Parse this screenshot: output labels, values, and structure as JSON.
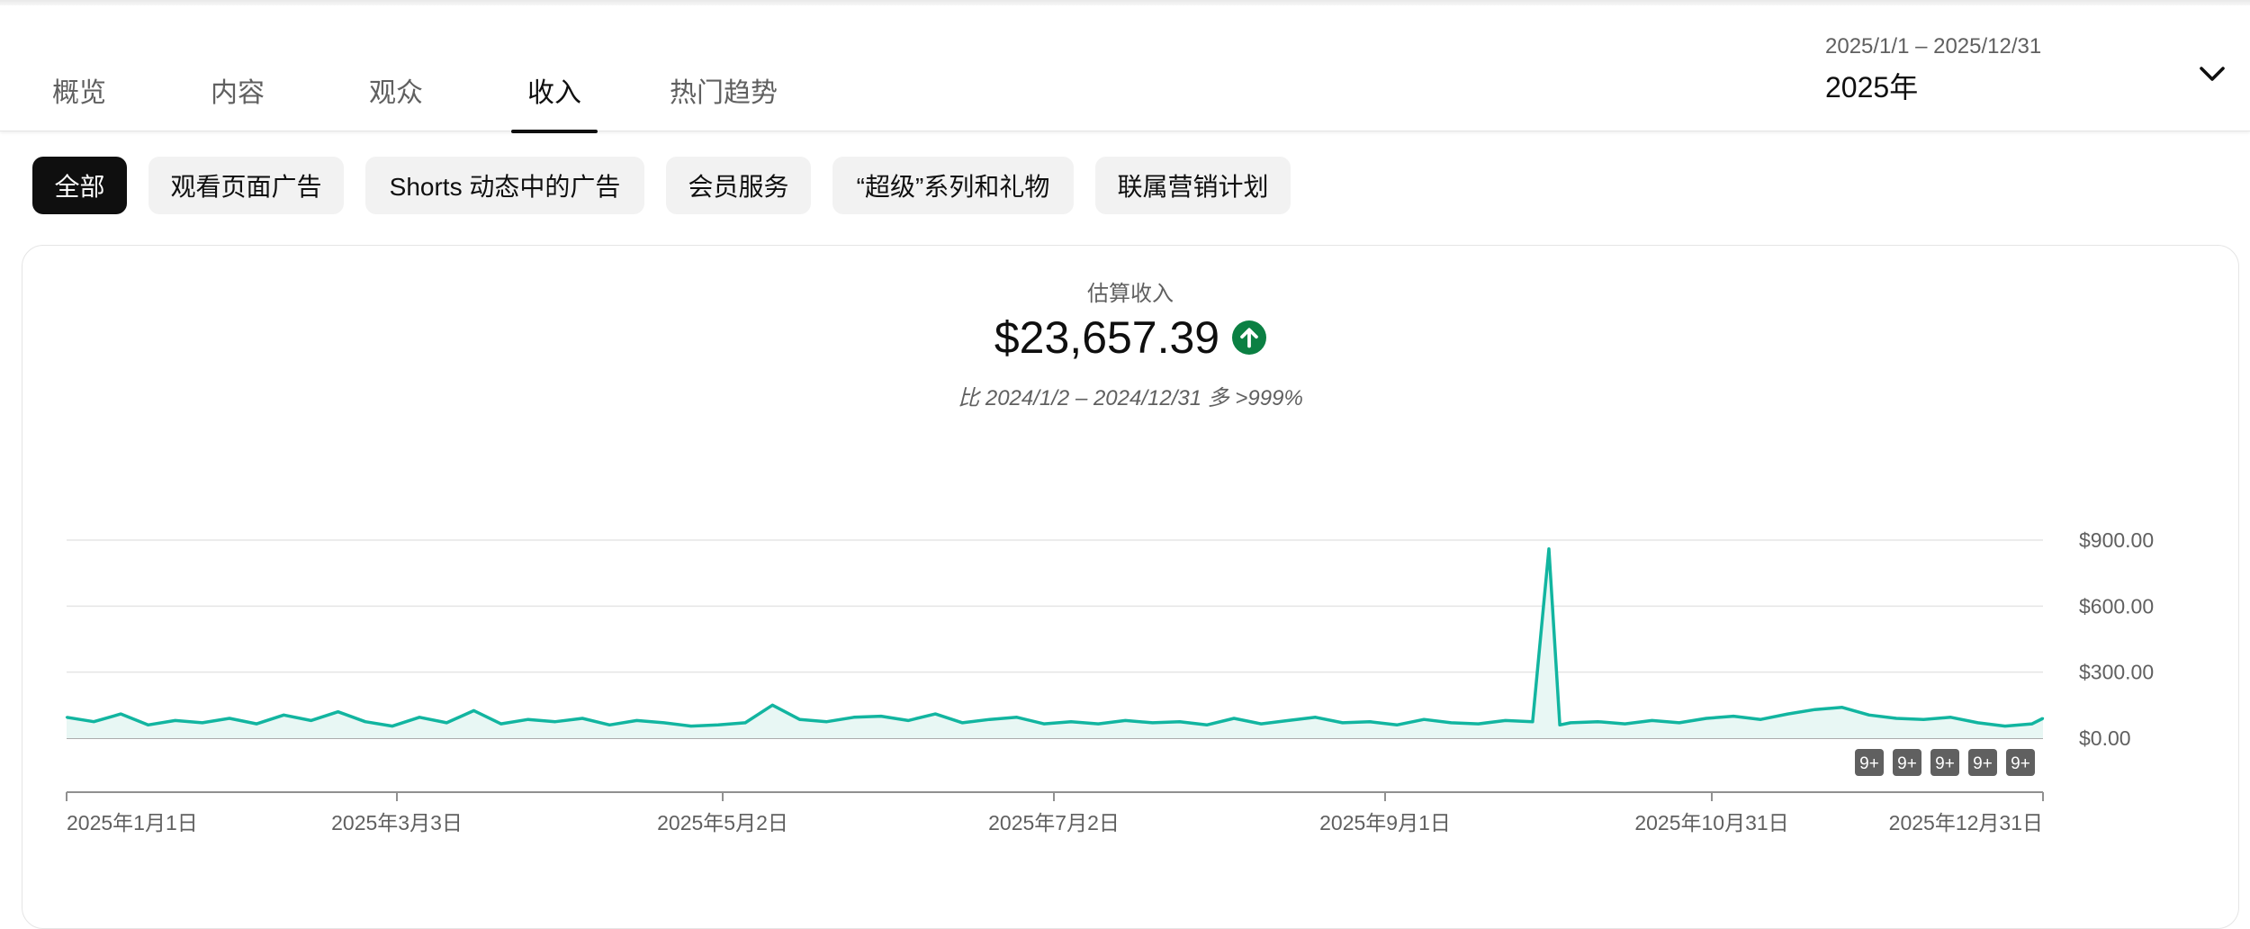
{
  "tabs": [
    {
      "label": "概览",
      "active": false
    },
    {
      "label": "内容",
      "active": false
    },
    {
      "label": "观众",
      "active": false
    },
    {
      "label": "收入",
      "active": true
    },
    {
      "label": "热门趋势",
      "active": false
    }
  ],
  "date_range": {
    "range": "2025/1/1 – 2025/12/31",
    "label": "2025年"
  },
  "chips": [
    {
      "label": "全部",
      "active": true
    },
    {
      "label": "观看页面广告",
      "active": false
    },
    {
      "label": "Shorts 动态中的广告",
      "active": false
    },
    {
      "label": "会员服务",
      "active": false
    },
    {
      "label": "“超级”系列和礼物",
      "active": false
    },
    {
      "label": "联属营销计划",
      "active": false
    }
  ],
  "metric": {
    "label": "估算收入",
    "value": "$23,657.39",
    "trend_icon": "arrow-up-circle-icon",
    "trend_color": "#0b8043",
    "comparison": "比 2024/1/2 – 2024/12/31 多 >999%"
  },
  "colors": {
    "line": "#12b5a0",
    "area": "#e8f7f4"
  },
  "chart_data": {
    "type": "area",
    "x_ticks": [
      "2025年1月1日",
      "2025年3月3日",
      "2025年5月2日",
      "2025年7月2日",
      "2025年9月1日",
      "2025年10月31日",
      "2025年12月31日"
    ],
    "y_ticks": [
      "$0.00",
      "$300.00",
      "$600.00",
      "$900.00"
    ],
    "ylim": [
      0,
      900
    ],
    "xlim": [
      "2025-01-01",
      "2025-12-31"
    ],
    "grid": true,
    "markers": [
      "9+",
      "9+",
      "9+",
      "9+",
      "9+"
    ],
    "series": [
      {
        "x": [
          "2025-01-01",
          "2025-01-06",
          "2025-01-11",
          "2025-01-16",
          "2025-01-21",
          "2025-01-26",
          "2025-01-31",
          "2025-02-05",
          "2025-02-10",
          "2025-02-15",
          "2025-02-20",
          "2025-02-25",
          "2025-03-02",
          "2025-03-07",
          "2025-03-12",
          "2025-03-17",
          "2025-03-22",
          "2025-03-27",
          "2025-04-01",
          "2025-04-06",
          "2025-04-11",
          "2025-04-16",
          "2025-04-21",
          "2025-04-26",
          "2025-05-01",
          "2025-05-06",
          "2025-05-11",
          "2025-05-16",
          "2025-05-21",
          "2025-05-26",
          "2025-05-31",
          "2025-06-05",
          "2025-06-10",
          "2025-06-15",
          "2025-06-20",
          "2025-06-25",
          "2025-06-30",
          "2025-07-05",
          "2025-07-10",
          "2025-07-15",
          "2025-07-20",
          "2025-07-25",
          "2025-07-30",
          "2025-08-04",
          "2025-08-09",
          "2025-08-14",
          "2025-08-19",
          "2025-08-24",
          "2025-08-29",
          "2025-09-03",
          "2025-09-08",
          "2025-09-13",
          "2025-09-18",
          "2025-09-23",
          "2025-09-28",
          "2025-10-01",
          "2025-10-03",
          "2025-10-05",
          "2025-10-10",
          "2025-10-15",
          "2025-10-20",
          "2025-10-25",
          "2025-10-30",
          "2025-11-04",
          "2025-11-09",
          "2025-11-14",
          "2025-11-19",
          "2025-11-24",
          "2025-11-29",
          "2025-12-04",
          "2025-12-09",
          "2025-12-14",
          "2025-12-19",
          "2025-12-24",
          "2025-12-29",
          "2025-12-31"
        ],
        "y": [
          95,
          75,
          110,
          60,
          80,
          70,
          90,
          65,
          105,
          80,
          120,
          75,
          55,
          95,
          70,
          125,
          65,
          85,
          75,
          90,
          60,
          80,
          70,
          55,
          60,
          70,
          150,
          85,
          75,
          95,
          100,
          80,
          110,
          70,
          85,
          95,
          65,
          75,
          65,
          80,
          70,
          75,
          60,
          90,
          65,
          80,
          95,
          70,
          75,
          60,
          85,
          70,
          65,
          80,
          75,
          860,
          60,
          70,
          75,
          65,
          80,
          70,
          90,
          100,
          85,
          110,
          130,
          140,
          105,
          90,
          85,
          95,
          70,
          55,
          65,
          90
        ]
      }
    ]
  }
}
